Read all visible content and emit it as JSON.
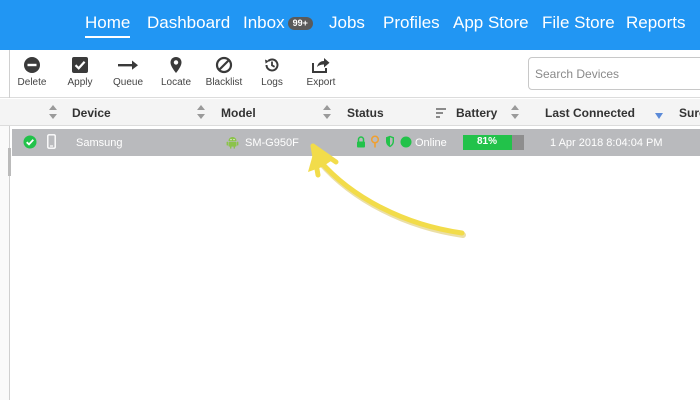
{
  "nav": {
    "items": [
      {
        "label": "Home"
      },
      {
        "label": "Dashboard"
      },
      {
        "label": "Inbox",
        "badge": "99+"
      },
      {
        "label": "Jobs"
      },
      {
        "label": "Profiles"
      },
      {
        "label": "App Store"
      },
      {
        "label": "File Store"
      },
      {
        "label": "Reports"
      }
    ],
    "active": "Home"
  },
  "toolbar": {
    "delete": "Delete",
    "apply": "Apply",
    "queue": "Queue",
    "locate": "Locate",
    "blacklist": "Blacklist",
    "logs": "Logs",
    "export": "Export"
  },
  "search": {
    "placeholder": "Search Devices",
    "value": ""
  },
  "table": {
    "columns": [
      "Device",
      "Model",
      "Status",
      "Battery",
      "Last Connected",
      "Sure"
    ],
    "rows": [
      {
        "device": "Samsung",
        "model": "SM-G950F",
        "status": "Online",
        "battery": "81%",
        "battery_level": 81,
        "last_connected": "1 Apr 2018 8:04:04 PM"
      }
    ]
  },
  "colors": {
    "nav_bg": "#2196f3",
    "row_selected": "#b9babd",
    "online": "#22c24a",
    "lock": "#22c24a",
    "location": "#f0a030",
    "annotation_arrow": "#f2dc4a"
  },
  "icons": {
    "delete": "minus-circle-icon",
    "apply": "checkbox-icon",
    "queue": "arrow-right-icon",
    "locate": "map-pin-icon",
    "blacklist": "ban-icon",
    "logs": "history-icon",
    "export": "share-icon",
    "row_check": "check-circle-icon",
    "device_type": "phone-icon",
    "os": "android-icon"
  }
}
